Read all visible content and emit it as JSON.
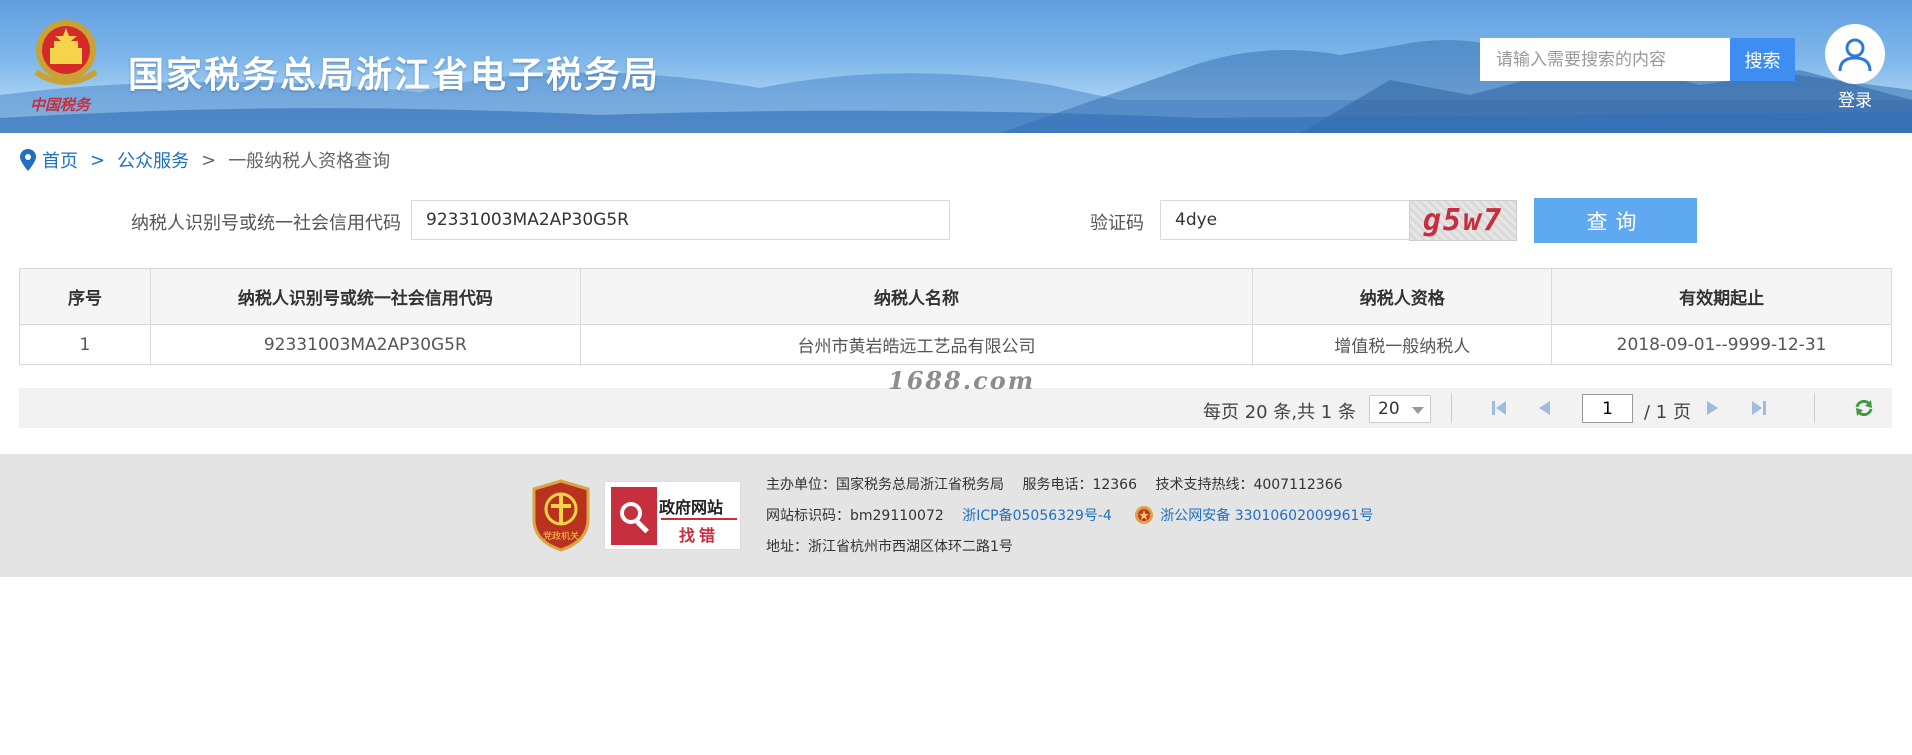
{
  "header": {
    "emblem_caption": "中国税务",
    "site_title": "国家税务总局浙江省电子税务局",
    "search_placeholder": "请输入需要搜索的内容",
    "search_button": "搜索",
    "login_label": "登录"
  },
  "breadcrumb": {
    "home": "首页",
    "separator": ">",
    "public_service": "公众服务",
    "current": "一般纳税人资格查询"
  },
  "form": {
    "taxpayer_id_label": "纳税人识别号或统一社会信用代码",
    "taxpayer_id_value": "92331003MA2AP30G5R",
    "captcha_label": "验证码",
    "captcha_value": "4dye",
    "captcha_image_text": "g5w7",
    "query_button": "查询"
  },
  "table": {
    "headers": [
      "序号",
      "纳税人识别号或统一社会信用代码",
      "纳税人名称",
      "纳税人资格",
      "有效期起止"
    ],
    "rows": [
      [
        "1",
        "92331003MA2AP30G5R",
        "台州市黄岩皓远工艺品有限公司",
        "增值税一般纳税人",
        "2018-09-01--9999-12-31"
      ]
    ]
  },
  "watermark": "1688.com",
  "pager": {
    "summary": "每页 20 条,共 1 条",
    "page_size": "20",
    "current_page": "1",
    "total_pages_text": "/ 1 页"
  },
  "footer": {
    "party_badge_text": "党政机关",
    "gov_error_title": "政府网站",
    "gov_error_subtitle": "找错",
    "sponsor": "主办单位：国家税务总局浙江省税务局",
    "service_phone": "服务电话：12366",
    "support_hotline": "技术支持热线：4007112366",
    "site_id": "网站标识码：bm29110072",
    "icp": "浙ICP备05056329号-4",
    "police_record": "浙公网安备 33010602009961号",
    "address": "地址：浙江省杭州市西湖区体环二路1号"
  },
  "colors": {
    "header_blue": "#5f9fe0",
    "search_button": "#3d8ef0",
    "query_button": "#5ea9ef",
    "link_blue": "#1f6fc4",
    "captcha_red": "#c62f3d",
    "footer_bg": "#e4e4e4"
  },
  "icons": [
    "national-emblem-icon",
    "location-pin-icon",
    "user-icon",
    "first-page-icon",
    "prev-page-icon",
    "next-page-icon",
    "last-page-icon",
    "refresh-icon",
    "party-badge-icon",
    "magnifier-flag-icon",
    "police-badge-icon"
  ]
}
